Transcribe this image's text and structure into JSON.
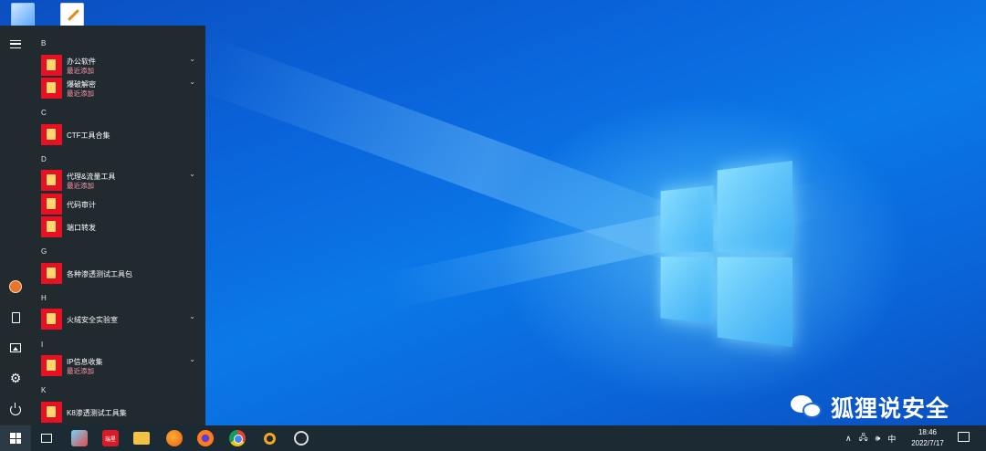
{
  "start_menu": {
    "groups": [
      {
        "letter": "B",
        "apps": [
          {
            "name": "办公软件",
            "sub": "最近添加",
            "expandable": true
          },
          {
            "name": "爆破解密",
            "sub": "最近添加",
            "expandable": true
          }
        ]
      },
      {
        "letter": "C",
        "apps": [
          {
            "name": "CTF工具合集",
            "sub": "",
            "expandable": false
          }
        ]
      },
      {
        "letter": "D",
        "apps": [
          {
            "name": "代理&流量工具",
            "sub": "最近添加",
            "expandable": true
          },
          {
            "name": "代码审计",
            "sub": "",
            "expandable": false
          },
          {
            "name": "端口转发",
            "sub": "",
            "expandable": false
          }
        ]
      },
      {
        "letter": "G",
        "apps": [
          {
            "name": "各种渗透测试工具包",
            "sub": "",
            "expandable": false
          }
        ]
      },
      {
        "letter": "H",
        "apps": [
          {
            "name": "火绒安全实验室",
            "sub": "",
            "expandable": true
          }
        ]
      },
      {
        "letter": "I",
        "apps": [
          {
            "name": "IP信息收集",
            "sub": "最近添加",
            "expandable": true
          }
        ]
      },
      {
        "letter": "K",
        "apps": [
          {
            "name": "K8渗透测试工具集",
            "sub": "",
            "expandable": false
          }
        ]
      }
    ],
    "rail_icons": [
      "menu-icon",
      "user-avatar",
      "documents-icon",
      "pictures-icon",
      "settings-icon",
      "power-icon"
    ]
  },
  "taskbar": {
    "pinned": [
      "task-view-icon",
      "screenshot-tool-icon",
      "red-app-icon",
      "file-explorer-icon",
      "firefox-icon",
      "firefox-dev-icon",
      "chrome-icon",
      "search-tool-icon",
      "unity-icon"
    ],
    "red_app_label": "瑞星",
    "tray": {
      "chevron": "∧",
      "ime": "中"
    },
    "clock": {
      "time": "18:46",
      "date": "2022/7/17"
    }
  },
  "watermark": {
    "text": "狐狸说安全"
  },
  "colors": {
    "accent": "#e81123",
    "recent": "#ff9aa8",
    "menu_bg": "#202a2f",
    "taskbar_bg": "#1b2a33"
  }
}
